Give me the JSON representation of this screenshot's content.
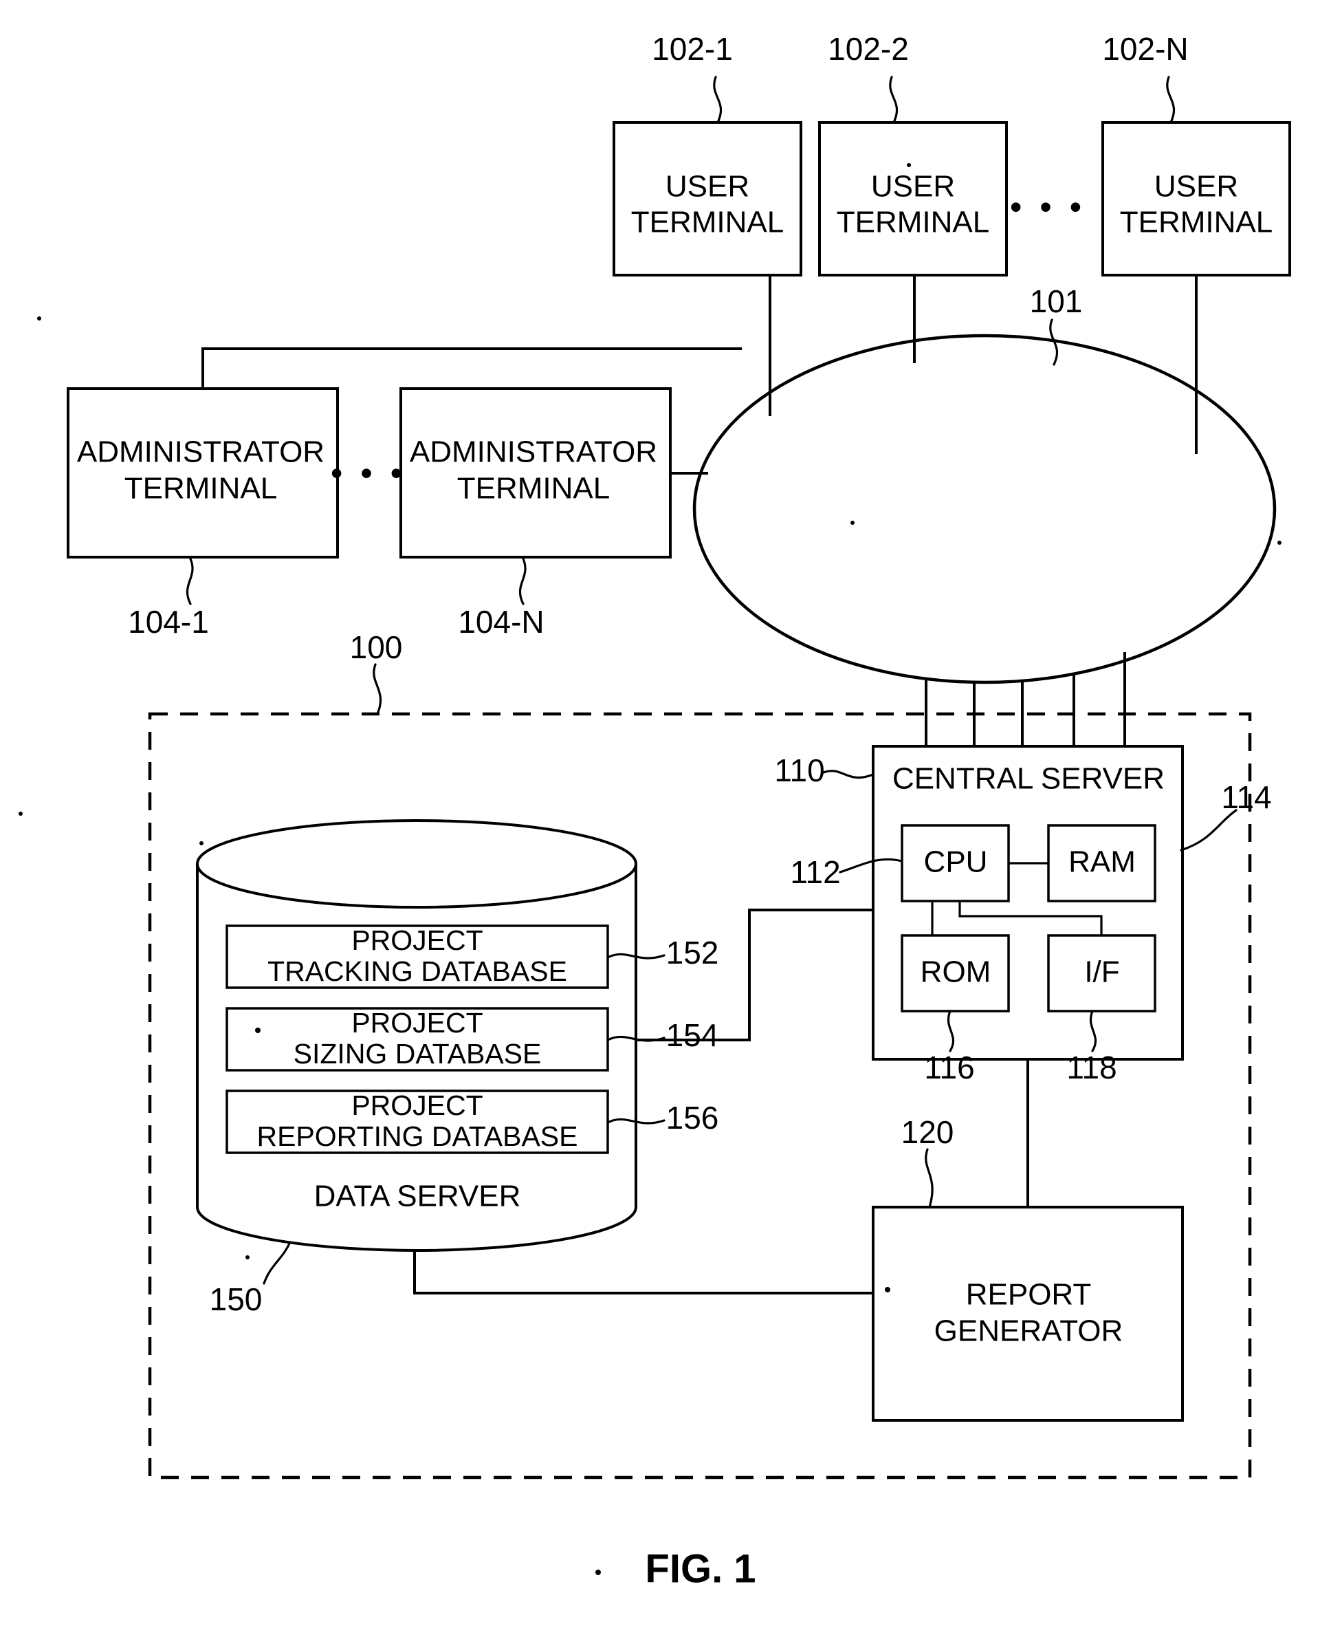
{
  "figure": {
    "caption": "FIG. 1",
    "system_ref": "100",
    "network_ref": "101"
  },
  "user_terminals": [
    {
      "label_line1": "USER",
      "label_line2": "TERMINAL",
      "ref": "102-1"
    },
    {
      "label_line1": "USER",
      "label_line2": "TERMINAL",
      "ref": "102-2"
    },
    {
      "label_line1": "USER",
      "label_line2": "TERMINAL",
      "ref": "102-N"
    }
  ],
  "user_terminal_ellipsis": "• • •",
  "administrator_terminals": [
    {
      "label_line1": "ADMINISTRATOR",
      "label_line2": "TERMINAL",
      "ref": "104-1"
    },
    {
      "label_line1": "ADMINISTRATOR",
      "label_line2": "TERMINAL",
      "ref": "104-N"
    }
  ],
  "administrator_terminal_ellipsis": "• • •",
  "central_server": {
    "title": "CENTRAL SERVER",
    "ref": "110",
    "components": [
      {
        "label": "CPU",
        "ref": "112"
      },
      {
        "label": "RAM",
        "ref": "114"
      },
      {
        "label": "ROM",
        "ref": "116"
      },
      {
        "label": "I/F",
        "ref": "118"
      }
    ]
  },
  "data_server": {
    "label": "DATA SERVER",
    "ref": "150",
    "databases": [
      {
        "line1": "PROJECT",
        "line2": "TRACKING DATABASE",
        "ref": "152"
      },
      {
        "line1": "PROJECT",
        "line2": "SIZING DATABASE",
        "ref": "154"
      },
      {
        "line1": "PROJECT",
        "line2": "REPORTING DATABASE",
        "ref": "156"
      }
    ]
  },
  "report_generator": {
    "line1": "REPORT",
    "line2": "GENERATOR",
    "ref": "120"
  }
}
